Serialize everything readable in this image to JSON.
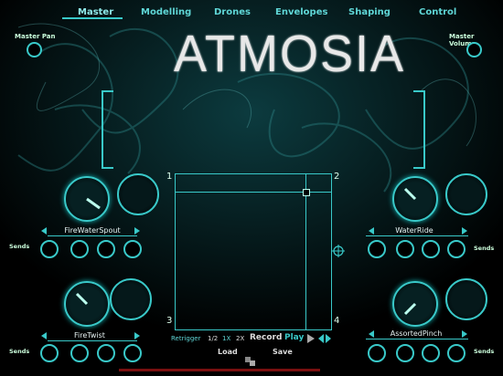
{
  "tabs": [
    "Master",
    "Modelling",
    "Drones",
    "Envelopes",
    "Shaping",
    "Control"
  ],
  "title": "ATMOSIA",
  "master_pan_label": "Master Pan",
  "master_volume_label": "Master Volume",
  "slots": [
    {
      "name": "FireWaterSpout"
    },
    {
      "name": "WaterRide"
    },
    {
      "name": "FireTwist"
    },
    {
      "name": "AssortedPinch"
    }
  ],
  "sends_label": "Sends",
  "xy_corners": [
    "1",
    "2",
    "3",
    "4"
  ],
  "transport": {
    "retrigger": "Retrigger",
    "half": "1/2",
    "one": "1X",
    "two": "2X",
    "record": "Record",
    "play": "Play"
  },
  "load_label": "Load",
  "save_label": "Save",
  "accent_color": "#39c9c9"
}
